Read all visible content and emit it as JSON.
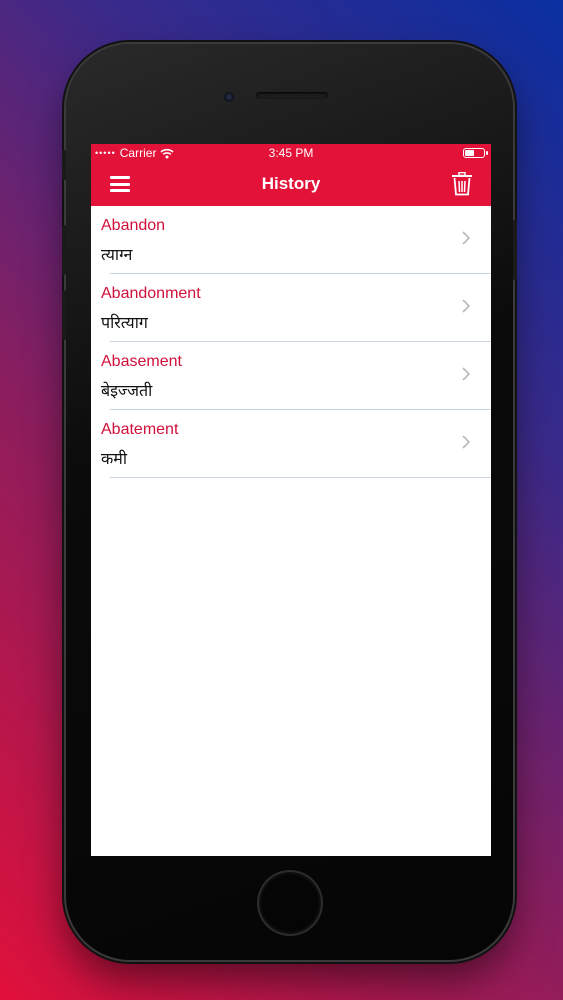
{
  "status_bar": {
    "carrier": "Carrier",
    "time": "3:45 PM"
  },
  "nav": {
    "title": "History",
    "menu_icon": "hamburger-menu-icon",
    "delete_icon": "trash-icon"
  },
  "history": [
    {
      "word": "Abandon",
      "meaning": "त्याग्न"
    },
    {
      "word": "Abandonment",
      "meaning": "परित्याग"
    },
    {
      "word": "Abasement",
      "meaning": "बेइज्जती"
    },
    {
      "word": "Abatement",
      "meaning": "कमी"
    }
  ],
  "colors": {
    "accent": "#e31238",
    "word_text": "#d0103a"
  }
}
